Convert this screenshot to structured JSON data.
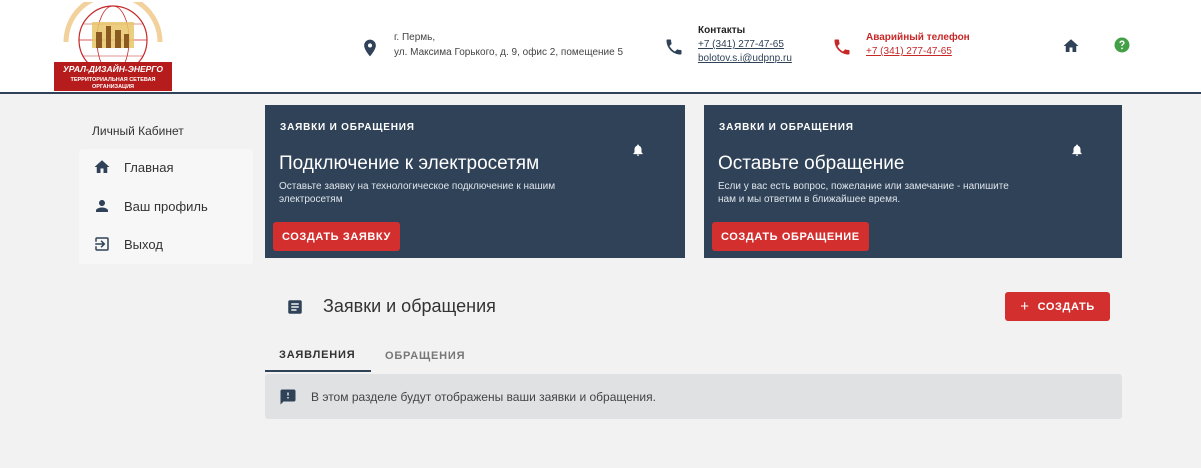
{
  "header": {
    "logo": {
      "top_arc": "ОБЩЕСТВО С ОГРАНИЧЕННОЙ ОТВЕТСТВЕННОСТЬЮ",
      "name": "УРАЛ-ДИЗАЙН-ЭНЕРГО",
      "sub1": "ТЕРРИТОРИАЛЬНАЯ СЕТЕВАЯ",
      "sub2": "ОРГАНИЗАЦИЯ"
    },
    "address_line1": "г. Пермь,",
    "address_line2": "ул. Максима Горького, д. 9, офис 2, помещение 5",
    "contacts_title": "Контакты",
    "contacts_phone": "+7 (341) 277-47-65",
    "contacts_email": "bolotov.s.i@udpnp.ru",
    "emergency_title": "Аварийный телефон",
    "emergency_phone": "+7 (341) 277-47-65",
    "icons": [
      "location-icon",
      "phone-icon",
      "home-icon",
      "help-icon"
    ]
  },
  "sidebar": {
    "title": "Личный Кабинет",
    "items": [
      {
        "label": "Главная",
        "icon": "home-icon"
      },
      {
        "label": "Ваш профиль",
        "icon": "person-icon"
      },
      {
        "label": "Выход",
        "icon": "logout-icon"
      }
    ]
  },
  "cards": [
    {
      "category": "ЗАЯВКИ И ОБРАЩЕНИЯ",
      "title": "Подключение к электросетям",
      "description": "Оставьте заявку на технологическое подключение к нашим электросетям",
      "button": "СОЗДАТЬ ЗАЯВКУ"
    },
    {
      "category": "ЗАЯВКИ И ОБРАЩЕНИЯ",
      "title": "Оставьте обращение",
      "description": "Если у вас есть вопрос, пожелание или замечание - напишите нам и мы ответим в ближайшее время.",
      "button": "СОЗДАТЬ ОБРАЩЕНИЕ"
    }
  ],
  "section": {
    "title": "Заявки и обращения",
    "create_button": "СОЗДАТЬ",
    "create_plus": "+",
    "tabs": [
      "ЗАЯВЛЕНИЯ",
      "ОБРАЩЕНИЯ"
    ],
    "active_tab": "ЗАЯВЛЕНИЯ",
    "info_text": "В этом разделе будут отображены ваши заявки и обращения."
  },
  "colors": {
    "primary_dark": "#2f4257",
    "accent_red": "#d32f2f",
    "background": "#f2f2f2",
    "help_green": "#43a047"
  }
}
